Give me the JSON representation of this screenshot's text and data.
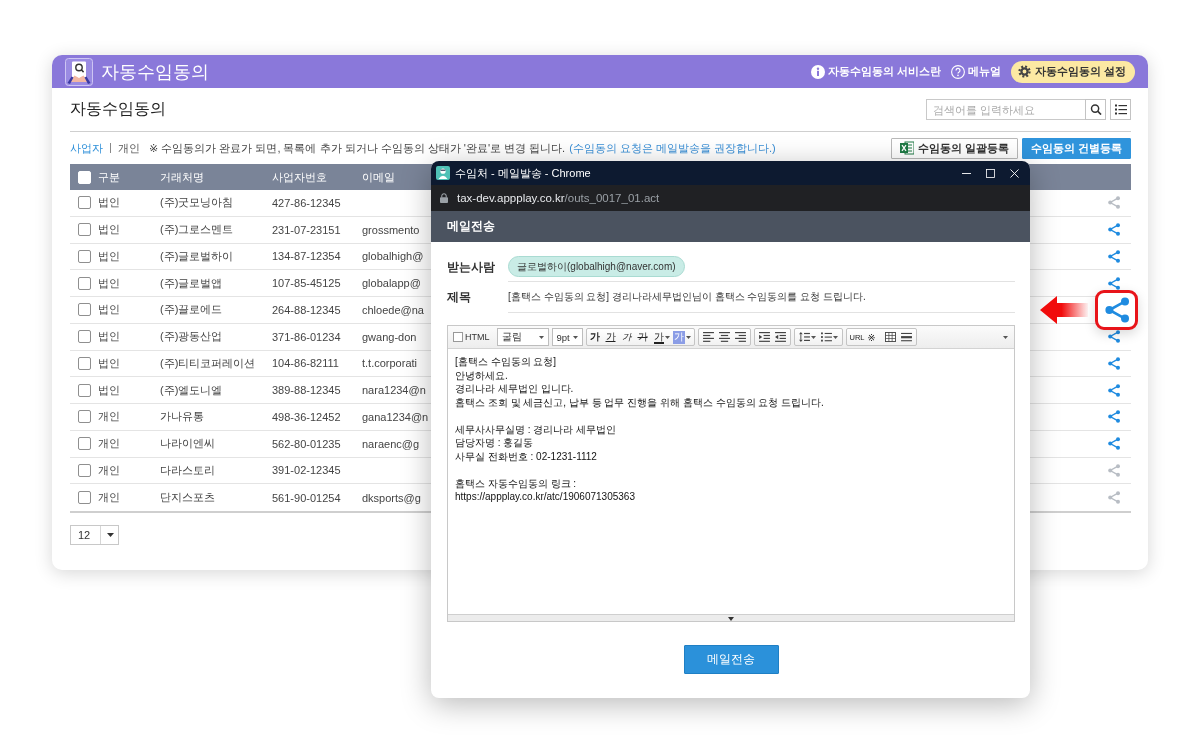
{
  "app_header": {
    "title": "자동수임동의",
    "links": [
      {
        "kind": "info",
        "label": "자동수임동의 서비스란"
      },
      {
        "kind": "help",
        "label": "메뉴얼"
      }
    ],
    "settings_button": "자동수임동의 설정"
  },
  "page": {
    "title": "자동수임동의",
    "search": {
      "placeholder": "검색어를 입력하세요"
    }
  },
  "filter_tabs": [
    {
      "label": "사업자",
      "selected": true
    },
    {
      "label": "개인",
      "selected": false
    }
  ],
  "notice": {
    "text": "※ 수임동의가 완료가 되면, 목록에 추가 되거나 수임동의 상태가 '완료'로 변경 됩니다.",
    "recommendation": "(수임동의 요청은 메일발송을 권장합니다.)"
  },
  "actions": [
    {
      "kind": "bulk",
      "label": "수임동의 일괄등록"
    },
    {
      "kind": "single",
      "label": "수임동의 건별등록"
    }
  ],
  "table": {
    "header_checked": false,
    "columns": [
      "구분",
      "거래처명",
      "사업자번호",
      "이메일"
    ],
    "rows": [
      {
        "checked": false,
        "type": "법인",
        "name": "(주)굿모닝아침",
        "business_number": "427-86-12345",
        "share_active": false
      },
      {
        "checked": false,
        "type": "법인",
        "name": "(주)그로스멘트",
        "business_number": "231-07-23151",
        "email": "grossmento",
        "share_active": true
      },
      {
        "checked": false,
        "type": "법인",
        "name": "(주)글로벌하이",
        "business_number": "134-87-12354",
        "email": "globalhigh@",
        "share_active": true
      },
      {
        "checked": false,
        "type": "법인",
        "name": "(주)글로벌앱",
        "business_number": "107-85-45125",
        "email": "globalapp@",
        "share_active": true
      },
      {
        "checked": false,
        "type": "법인",
        "name": "(주)끌로에드",
        "business_number": "264-88-12345",
        "email": "chloede@na"
      },
      {
        "checked": false,
        "type": "법인",
        "name": "(주)광동산업",
        "business_number": "371-86-01234",
        "email": "gwang-don",
        "share_active": true
      },
      {
        "checked": false,
        "type": "법인",
        "name": "(주)티티코퍼레이션",
        "business_number": "104-86-82111",
        "email": "t.t.corporati",
        "share_active": true
      },
      {
        "checked": false,
        "type": "법인",
        "name": "(주)엘도니엘",
        "business_number": "389-88-12345",
        "email": "nara1234@n",
        "share_active": true
      },
      {
        "checked": false,
        "type": "개인",
        "name": "가나유통",
        "business_number": "498-36-12452",
        "email": "gana1234@n",
        "share_active": true
      },
      {
        "checked": false,
        "type": "개인",
        "name": "나라이엔씨",
        "business_number": "562-80-01235",
        "email": "naraenc@g",
        "share_active": true
      },
      {
        "checked": false,
        "type": "개인",
        "name": "다라스토리",
        "business_number": "391-02-12345",
        "share_active": false
      },
      {
        "checked": false,
        "type": "개인",
        "name": "단지스포츠",
        "business_number": "561-90-01254",
        "email": "dksports@g",
        "share_active": false
      }
    ]
  },
  "page_size": "12",
  "popup": {
    "window_title": "수임처 - 메일발송 - Chrome",
    "url": {
      "host": "tax-dev.appplay.co.kr",
      "path": "/outs_0017_01.act"
    },
    "heading": "메일전송",
    "recipient": {
      "label": "받는사람",
      "value": "글로벌하이(globalhigh@naver.com)"
    },
    "subject": {
      "label": "제목",
      "value": "[홈택스 수임동의 요청] 경리나라세무법인님이 홈택스 수임동의를 요청 드립니다."
    },
    "editor": {
      "html": {
        "label": "HTML",
        "checked": false
      },
      "font": "굴림",
      "size": "9pt",
      "tool_groups": [
        [
          {
            "kind": "bold",
            "label": "가"
          },
          {
            "kind": "underline",
            "label": "가"
          },
          {
            "kind": "italic",
            "label": "가"
          },
          {
            "kind": "strike",
            "label": "가"
          },
          {
            "kind": "color",
            "label": "가"
          },
          {
            "kind": "highlight",
            "label": "가"
          }
        ],
        [
          {
            "kind": "align-left"
          },
          {
            "kind": "align-center"
          },
          {
            "kind": "align-right"
          }
        ],
        [
          {
            "kind": "indent"
          },
          {
            "kind": "outdent"
          }
        ],
        [
          {
            "kind": "line-height"
          },
          {
            "kind": "list"
          }
        ],
        [
          {
            "kind": "link",
            "label": "URL"
          },
          {
            "kind": "symbol",
            "label": "※"
          },
          {
            "kind": "table"
          },
          {
            "kind": "rule"
          }
        ]
      ],
      "body": [
        [
          "[홈택스 수임동의 요청]",
          "안녕하세요.",
          "경리나라 세무법인 입니다.",
          "홈택스 조회 및 세금신고, 납부 등 업무 진행을 위해 홈택스 수임동의 요청 드립니다."
        ],
        [
          "세무사사무실명 : 경리나라 세무법인",
          "담당자명 : 홍길동",
          "사무실 전화번호 : 02-1231-1112"
        ],
        [
          "홈택스 자동수임동의 링크 :",
          "https://appplay.co.kr/atc/1906071305363"
        ]
      ]
    },
    "send_button": "메일전송"
  }
}
